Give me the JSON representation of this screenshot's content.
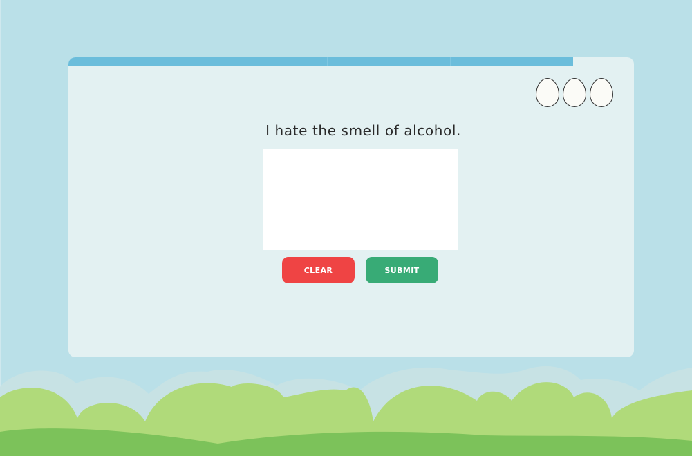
{
  "progress": {
    "fraction": 0.893
  },
  "lives": {
    "count": 3,
    "icon": "egg-icon"
  },
  "question": {
    "before": "I ",
    "target": "hate",
    "after": " the smell of alcohol."
  },
  "buttons": {
    "clear_label": "CLEAR",
    "submit_label": "SUBMIT"
  },
  "colors": {
    "sky": "#bae0e8",
    "panel": "#e3f1f2",
    "progress": "#6bbddb",
    "clear": "#ef4444",
    "submit": "#38ab76",
    "hill_light": "#b0da7a",
    "hill_dark": "#7cc25a"
  }
}
